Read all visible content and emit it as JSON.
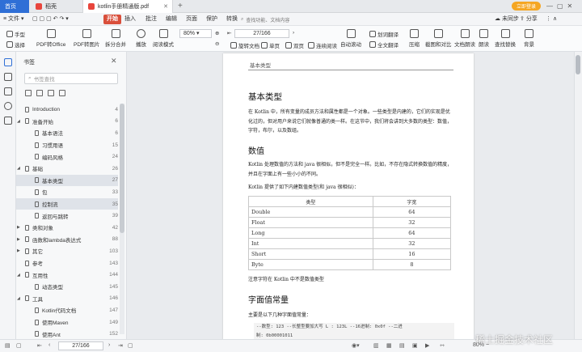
{
  "tabs": [
    {
      "label": "首页",
      "active": true
    },
    {
      "label": "稻壳",
      "active": false
    },
    {
      "label": "kotlin手册精通版.pdf",
      "active": false
    }
  ],
  "window": {
    "login_label": "立即登录"
  },
  "menu": {
    "file": "文件",
    "items": [
      "开始",
      "插入",
      "批注",
      "编辑",
      "页面",
      "保护",
      "转换"
    ],
    "search_placeholder": "查找功能、文档内容",
    "right": [
      "未同步",
      "分享"
    ]
  },
  "toolbar": {
    "hand": "手型",
    "select": "选择",
    "pdf_office": "PDF转Office",
    "pdf_image": "PDF转图片",
    "split_merge": "拆分合并",
    "play": "播放",
    "read_mode": "阅读模式",
    "zoom": "80%",
    "page_field": "27/166",
    "rotate": "旋转文档",
    "single": "单页",
    "double": "双页",
    "continuous": "连续阅读",
    "auto_scroll": "自动滚动",
    "translate_word": "划词翻译",
    "full_translate": "全文翻译",
    "compress": "压缩",
    "screenshot": "截图和对比",
    "tts": "文档朗读",
    "read_aloud": "朗读",
    "find_replace": "查找替换",
    "background": "背景"
  },
  "sidebar": {
    "title": "书签",
    "search_placeholder": "书签查找",
    "items": [
      {
        "label": "Introduction",
        "page": "4",
        "level": 0,
        "expanded": null,
        "selected": false
      },
      {
        "label": "准备开始",
        "page": "6",
        "level": 0,
        "expanded": true,
        "selected": false
      },
      {
        "label": "基本语法",
        "page": "6",
        "level": 1,
        "expanded": null,
        "selected": false
      },
      {
        "label": "习惯用语",
        "page": "15",
        "level": 1,
        "expanded": null,
        "selected": false
      },
      {
        "label": "编码风格",
        "page": "24",
        "level": 1,
        "expanded": null,
        "selected": false
      },
      {
        "label": "基础",
        "page": "26",
        "level": 0,
        "expanded": true,
        "selected": false
      },
      {
        "label": "基本类型",
        "page": "27",
        "level": 1,
        "expanded": null,
        "selected": true
      },
      {
        "label": "包",
        "page": "33",
        "level": 1,
        "expanded": null,
        "selected": false
      },
      {
        "label": "控制流",
        "page": "35",
        "level": 1,
        "expanded": null,
        "selected": true
      },
      {
        "label": "返回与跳转",
        "page": "39",
        "level": 1,
        "expanded": null,
        "selected": false
      },
      {
        "label": "类和对象",
        "page": "42",
        "level": 0,
        "expanded": false,
        "selected": false
      },
      {
        "label": "函数和lambda表达式",
        "page": "88",
        "level": 0,
        "expanded": false,
        "selected": false
      },
      {
        "label": "其它",
        "page": "103",
        "level": 0,
        "expanded": false,
        "selected": false
      },
      {
        "label": "参考",
        "page": "143",
        "level": 0,
        "expanded": null,
        "selected": false
      },
      {
        "label": "互用性",
        "page": "144",
        "level": 0,
        "expanded": true,
        "selected": false
      },
      {
        "label": "动态类型",
        "page": "145",
        "level": 1,
        "expanded": null,
        "selected": false
      },
      {
        "label": "工具",
        "page": "146",
        "level": 0,
        "expanded": true,
        "selected": false
      },
      {
        "label": "Kotlin代码文档",
        "page": "147",
        "level": 1,
        "expanded": null,
        "selected": false
      },
      {
        "label": "使用Maven",
        "page": "149",
        "level": 1,
        "expanded": null,
        "selected": false
      },
      {
        "label": "使用Ant",
        "page": "152",
        "level": 1,
        "expanded": null,
        "selected": false
      }
    ]
  },
  "document": {
    "running_header": "基本类型",
    "h1": "基本类型",
    "p1": "在 Kotlin 中，所有变量的成员方法和属性都是一个对象。一些类型是内建的，它们的实现是优化过的，但对用户来说它们就像普通的类一样。在这节中，我们将会讲到大多数的类型：数值，字符，布尔，以及数组。",
    "h2": "数值",
    "p2": "Kotlin 处理数值的方法和 java 很相似，但不是完全一样。比如，不存在隐式转换数值的精度，并且在字面上有一些小小的不同。",
    "p3": "Kotlin 提供了如下内建数值类型(和 java 很相似)：",
    "table": {
      "headers": [
        "类型",
        "字宽"
      ],
      "rows": [
        [
          "Double",
          "64"
        ],
        [
          "Float",
          "32"
        ],
        [
          "Long",
          "64"
        ],
        [
          "Int",
          "32"
        ],
        [
          "Short",
          "16"
        ],
        [
          "Byte",
          "8"
        ]
      ]
    },
    "p4": "注意字符在 Kotlin 中不是数值类型",
    "h3": "字面值常量",
    "p5": "主要是以下几种字面值常量：",
    "code1": "--数型: 123 --长整型要加大写 L : 123L --16进制: 0x0f --二进",
    "code2": "制: 0b00001011"
  },
  "status": {
    "page_field": "27/166",
    "zoom": "80%"
  },
  "watermark": "稀土掘金技术社区",
  "colors": {
    "accent": "#2f6fd6",
    "start_tab": "#d94f3b",
    "login": "#f5a623"
  }
}
